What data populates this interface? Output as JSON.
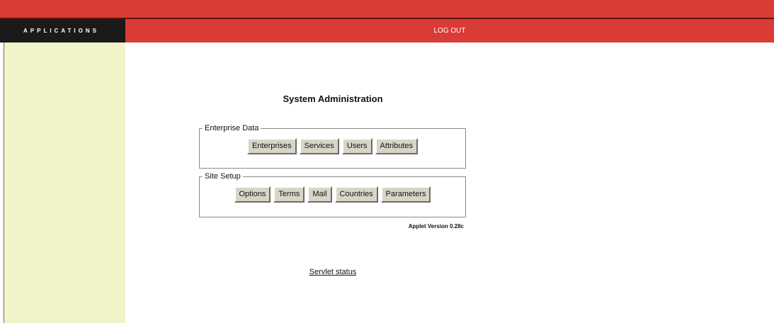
{
  "header": {
    "applications_label": "APPLICATIONS",
    "logout_label": "LOG OUT",
    "accent_color": "#d93b35",
    "sidebar_color": "#f2f3c8"
  },
  "main": {
    "title": "System Administration",
    "enterprise_data": {
      "legend": "Enterprise Data",
      "buttons": [
        "Enterprises",
        "Services",
        "Users",
        "Attributes"
      ]
    },
    "site_setup": {
      "legend": "Site Setup",
      "buttons": [
        "Options",
        "Terms",
        "Mail",
        "Countries",
        "Parameters"
      ]
    },
    "applet_version": "Applet Version 0.28c",
    "servlet_status_link": "Servlet status"
  }
}
